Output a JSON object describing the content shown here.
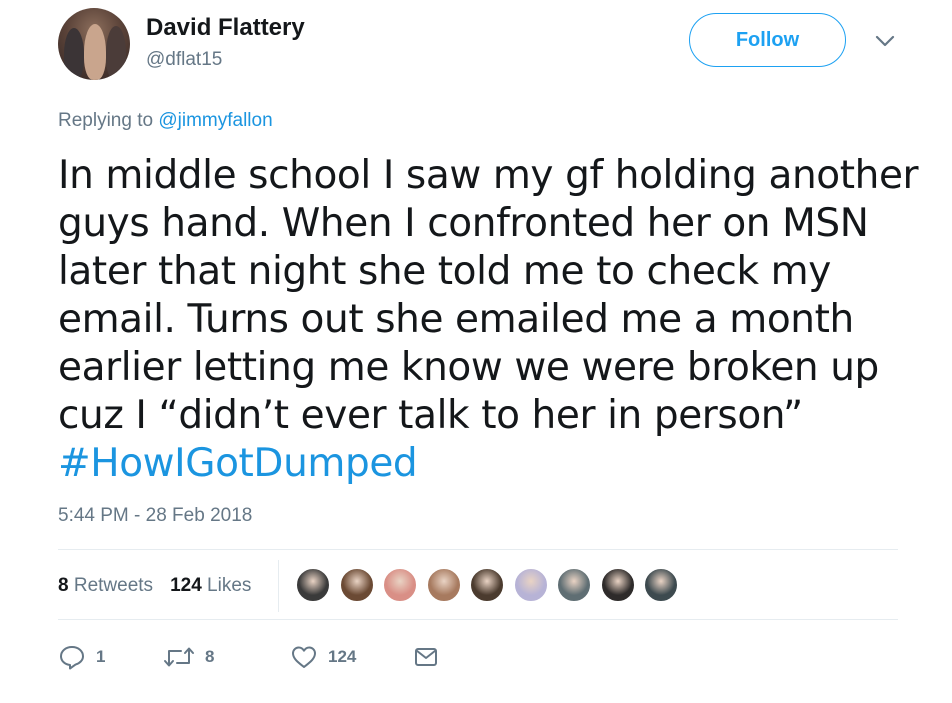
{
  "author": {
    "name": "David Flattery",
    "handle": "@dflat15",
    "avatar_icon": "profile-photo"
  },
  "header": {
    "follow_label": "Follow",
    "menu_icon": "chevron-down-icon"
  },
  "reply": {
    "prefix": "Replying to",
    "mention": "@jimmyfallon"
  },
  "tweet": {
    "lines": [
      "In middle school I saw my gf holding another",
      "guys hand. When I confronted her on MSN",
      "later that night she told me to check my",
      "email. Turns out she emailed me a month",
      "earlier letting me know we were broken up",
      "cuz I “didn’t ever talk to her in person”"
    ],
    "hashtag": "#HowIGotDumped",
    "timestamp": "5:44 PM - 28 Feb 2018"
  },
  "stats": {
    "retweets_count": "8",
    "retweets_label": "Retweets",
    "likes_count": "124",
    "likes_label": "Likes"
  },
  "likers": [
    {
      "name": "liker-avatar-1",
      "color": "#3a3a3a"
    },
    {
      "name": "liker-avatar-2",
      "color": "#6b4a34"
    },
    {
      "name": "liker-avatar-3",
      "color": "#d98f86"
    },
    {
      "name": "liker-avatar-4",
      "color": "#a77a5f"
    },
    {
      "name": "liker-avatar-5",
      "color": "#4b3b2e"
    },
    {
      "name": "liker-avatar-6",
      "color": "#b7b3d6"
    },
    {
      "name": "liker-avatar-7",
      "color": "#5f6e73"
    },
    {
      "name": "liker-avatar-8",
      "color": "#2e2b2a"
    },
    {
      "name": "liker-avatar-9",
      "color": "#3d4a4f"
    }
  ],
  "actions": {
    "reply_count": "1",
    "retweet_count": "8",
    "like_count": "124"
  },
  "colors": {
    "accent": "#1da1f2",
    "link": "#1b95e0",
    "secondary_text": "#657786",
    "divider": "#e6ecf0"
  }
}
